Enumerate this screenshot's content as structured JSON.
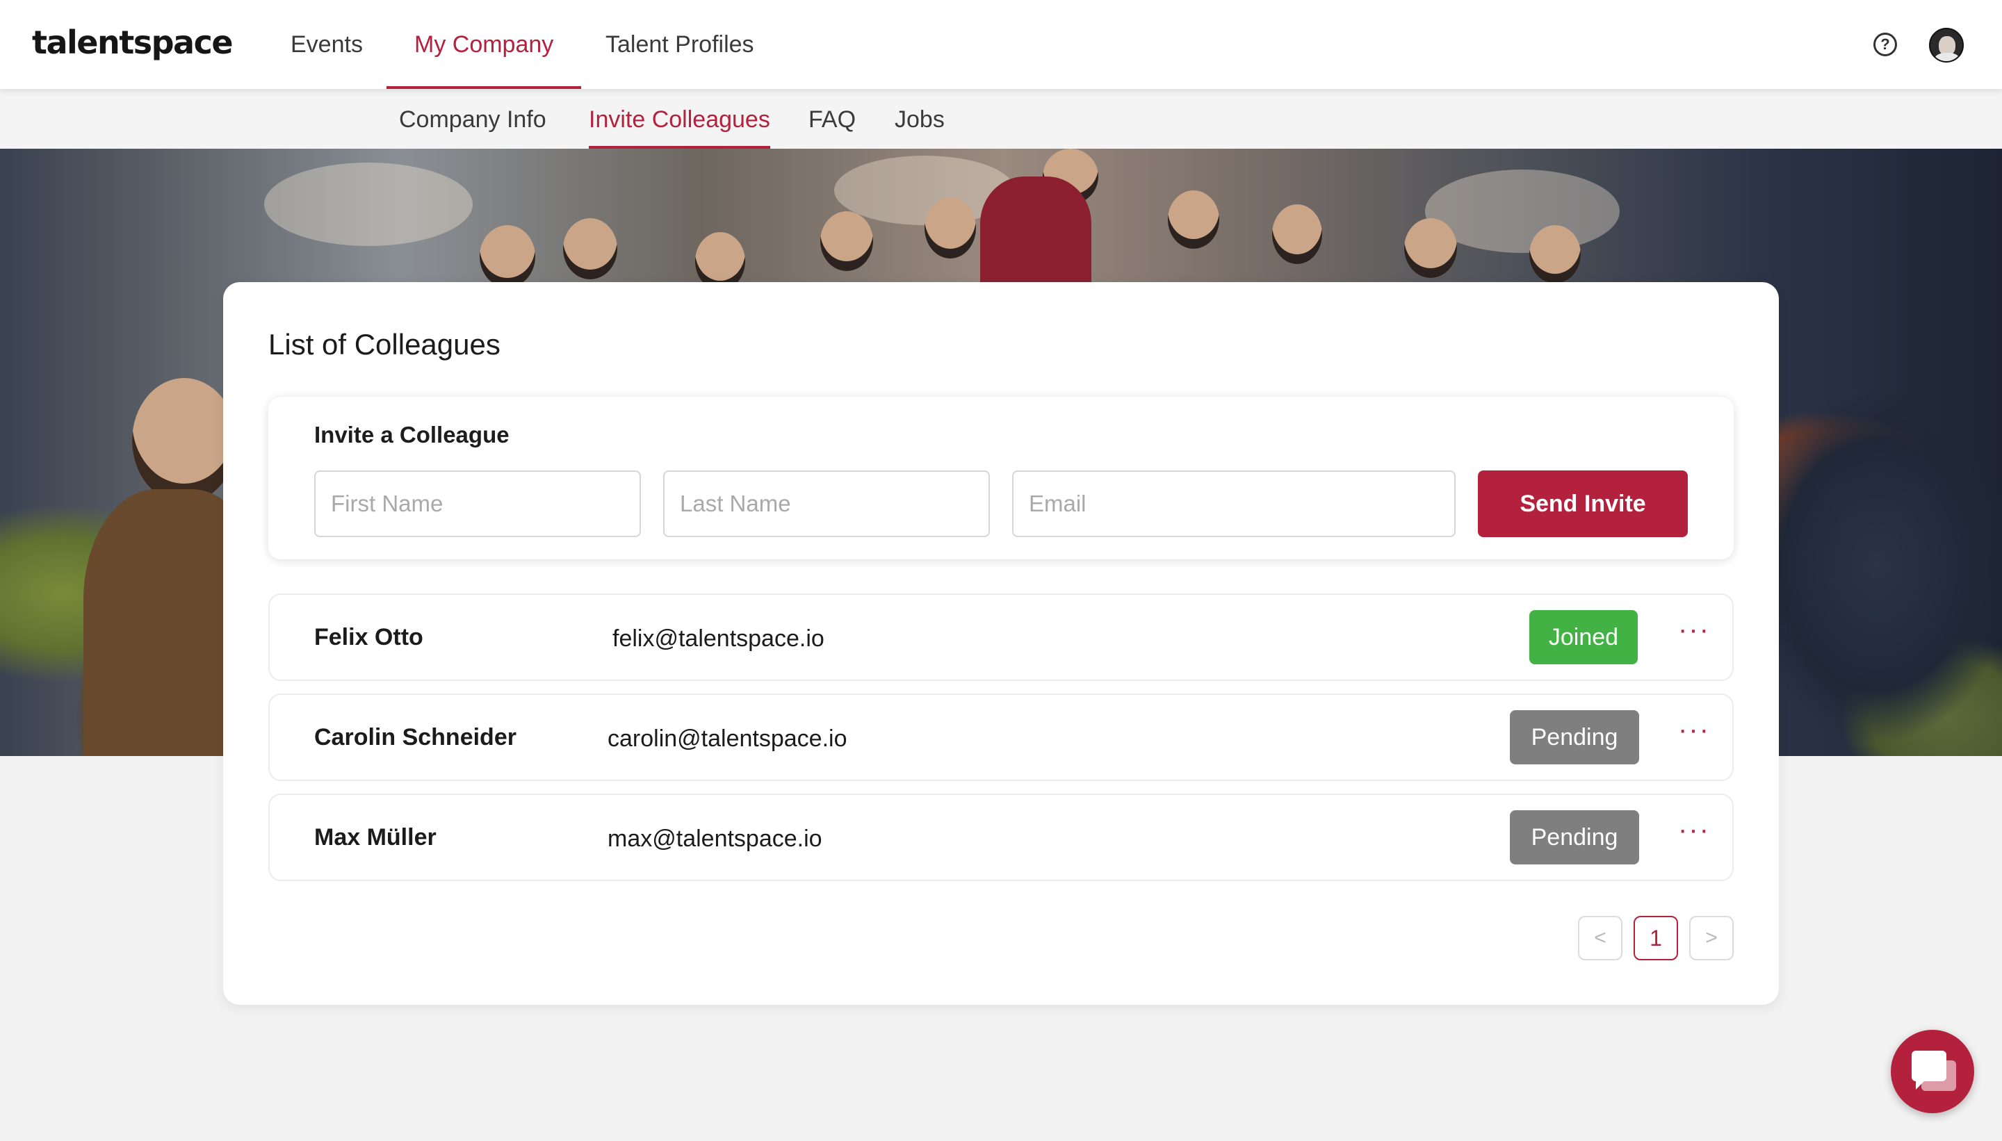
{
  "app": {
    "logo": "talentspace"
  },
  "main_nav": [
    {
      "label": "Events",
      "active": false
    },
    {
      "label": "My Company",
      "active": true
    },
    {
      "label": "Talent Profiles",
      "active": false
    }
  ],
  "header_icons": {
    "help": "help-circle-icon",
    "help_glyph": "?",
    "avatar": "user-avatar"
  },
  "sub_nav": [
    {
      "label": "Company Info",
      "active": false
    },
    {
      "label": "Invite Colleagues",
      "active": true
    },
    {
      "label": "FAQ",
      "active": false
    },
    {
      "label": "Jobs",
      "active": false
    }
  ],
  "card": {
    "title": "List of Colleagues"
  },
  "invite": {
    "title": "Invite a Colleague",
    "first_name_placeholder": "First Name",
    "last_name_placeholder": "Last Name",
    "email_placeholder": "Email",
    "send_label": "Send Invite"
  },
  "colleagues": [
    {
      "name": "Felix Otto",
      "email": "felix@talentspace.io",
      "status": "Joined"
    },
    {
      "name": "Carolin Schneider",
      "email": "carolin@talentspace.io",
      "status": "Pending"
    },
    {
      "name": "Max Müller",
      "email": "max@talentspace.io",
      "status": "Pending"
    }
  ],
  "more_glyph": "···",
  "pagination": {
    "prev": "<",
    "current": "1",
    "next": ">"
  },
  "colors": {
    "accent": "#b4213d",
    "joined": "#43b244",
    "pending": "#7f7f7f"
  },
  "chat": {
    "icon": "chat-bubble-icon"
  }
}
